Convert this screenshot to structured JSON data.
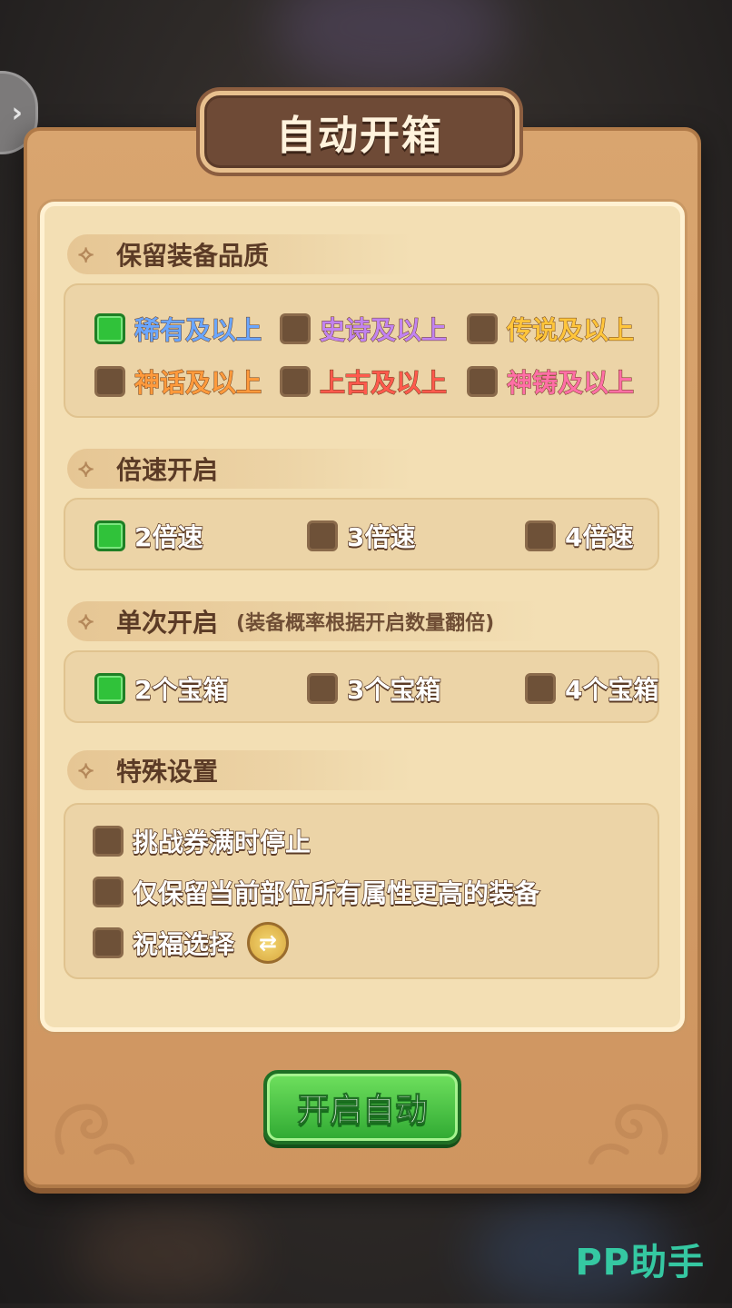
{
  "title": "自动开箱",
  "colors": {
    "rare": "#6aa6ff",
    "epic": "#c183f0",
    "legend": "#ffc53b",
    "myth": "#ff9a3c",
    "ancient": "#ff5a4d",
    "divine": "#ff6fa6"
  },
  "sections": {
    "quality": {
      "title": "保留装备品质",
      "options": [
        {
          "label": "稀有及以上",
          "checked": true
        },
        {
          "label": "史诗及以上",
          "checked": false
        },
        {
          "label": "传说及以上",
          "checked": false
        },
        {
          "label": "神话及以上",
          "checked": false
        },
        {
          "label": "上古及以上",
          "checked": false
        },
        {
          "label": "神铸及以上",
          "checked": false
        }
      ]
    },
    "speed": {
      "title": "倍速开启",
      "options": [
        {
          "label": "2倍速",
          "checked": true
        },
        {
          "label": "3倍速",
          "checked": false
        },
        {
          "label": "4倍速",
          "checked": false
        }
      ]
    },
    "single": {
      "title": "单次开启",
      "note": "(装备概率根据开启数量翻倍)",
      "options": [
        {
          "label": "2个宝箱",
          "checked": true
        },
        {
          "label": "3个宝箱",
          "checked": false
        },
        {
          "label": "4个宝箱",
          "checked": false
        }
      ]
    },
    "special": {
      "title": "特殊设置",
      "options": [
        {
          "label": "挑战券满时停止",
          "checked": false
        },
        {
          "label": "仅保留当前部位所有属性更高的装备",
          "checked": false
        },
        {
          "label": "祝福选择",
          "checked": false
        }
      ]
    }
  },
  "start_button": "开启自动",
  "watermark": "PP助手",
  "icons": {
    "back": "chevron-right-icon",
    "section": "leaf-icon",
    "swap": "swap-arrows-icon"
  }
}
